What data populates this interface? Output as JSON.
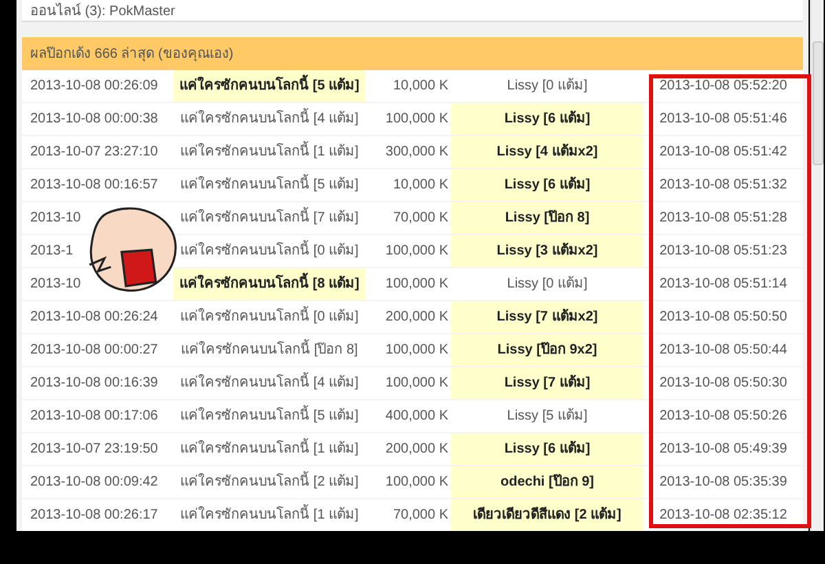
{
  "online_line": "ออนไลน์ (3): PokMaster",
  "results_header": "ผลป๊อกเด้ง 666 ล่าสุด (ของคุณเอง)",
  "rows": [
    {
      "time_1": "2013-10-08 00:26:09",
      "player_1": "แค่ใครซักคนบนโลกนี้ [5 แต้ม]",
      "player_1_won": true,
      "bet": "10,000 K",
      "player_2": "Lissy [0 แต้ม]",
      "player_2_won": false,
      "time_2": "2013-10-08 05:52:20"
    },
    {
      "time_1": "2013-10-08 00:00:38",
      "player_1": "แค่ใครซักคนบนโลกนี้ [4 แต้ม]",
      "player_1_won": false,
      "bet": "100,000 K",
      "player_2": "Lissy [6 แต้ม]",
      "player_2_won": true,
      "time_2": "2013-10-08 05:51:46"
    },
    {
      "time_1": "2013-10-07 23:27:10",
      "player_1": "แค่ใครซักคนบนโลกนี้ [1 แต้ม]",
      "player_1_won": false,
      "bet": "300,000 K",
      "player_2": "Lissy [4 แต้มx2]",
      "player_2_won": true,
      "time_2": "2013-10-08 05:51:42"
    },
    {
      "time_1": "2013-10-08 00:16:57",
      "player_1": "แค่ใครซักคนบนโลกนี้ [5 แต้ม]",
      "player_1_won": false,
      "bet": "10,000 K",
      "player_2": "Lissy [6 แต้ม]",
      "player_2_won": true,
      "time_2": "2013-10-08 05:51:32"
    },
    {
      "time_1": "2013-10",
      "player_1": "แค่ใครซักคนบนโลกนี้ [7 แต้ม]",
      "player_1_won": false,
      "bet": "70,000 K",
      "player_2": "Lissy [ป๊อก 8]",
      "player_2_won": true,
      "time_2": "2013-10-08 05:51:28"
    },
    {
      "time_1": "2013-1",
      "player_1": "แค่ใครซักคนบนโลกนี้ [0 แต้ม]",
      "player_1_won": false,
      "bet": "100,000 K",
      "player_2": "Lissy [3 แต้มx2]",
      "player_2_won": true,
      "time_2": "2013-10-08 05:51:23"
    },
    {
      "time_1": "2013-10",
      "player_1": "แค่ใครซักคนบนโลกนี้ [8 แต้ม]",
      "player_1_won": true,
      "bet": "100,000 K",
      "player_2": "Lissy [0 แต้ม]",
      "player_2_won": false,
      "time_2": "2013-10-08 05:51:14"
    },
    {
      "time_1": "2013-10-08 00:26:24",
      "player_1": "แค่ใครซักคนบนโลกนี้ [0 แต้ม]",
      "player_1_won": false,
      "bet": "200,000 K",
      "player_2": "Lissy [7 แต้มx2]",
      "player_2_won": true,
      "time_2": "2013-10-08 05:50:50"
    },
    {
      "time_1": "2013-10-08 00:00:27",
      "player_1": "แค่ใครซักคนบนโลกนี้ [ป๊อก 8]",
      "player_1_won": false,
      "bet": "100,000 K",
      "player_2": "Lissy [ป๊อก 9x2]",
      "player_2_won": true,
      "time_2": "2013-10-08 05:50:44"
    },
    {
      "time_1": "2013-10-08 00:16:39",
      "player_1": "แค่ใครซักคนบนโลกนี้ [4 แต้ม]",
      "player_1_won": false,
      "bet": "100,000 K",
      "player_2": "Lissy [7 แต้ม]",
      "player_2_won": true,
      "time_2": "2013-10-08 05:50:30"
    },
    {
      "time_1": "2013-10-08 00:17:06",
      "player_1": "แค่ใครซักคนบนโลกนี้ [5 แต้ม]",
      "player_1_won": false,
      "bet": "400,000 K",
      "player_2": "Lissy [5 แต้ม]",
      "player_2_won": false,
      "time_2": "2013-10-08 05:50:26"
    },
    {
      "time_1": "2013-10-07 23:19:50",
      "player_1": "แค่ใครซักคนบนโลกนี้ [1 แต้ม]",
      "player_1_won": false,
      "bet": "200,000 K",
      "player_2": "Lissy [6 แต้ม]",
      "player_2_won": true,
      "time_2": "2013-10-08 05:49:39"
    },
    {
      "time_1": "2013-10-08 00:09:42",
      "player_1": "แค่ใครซักคนบนโลกนี้ [2 แต้ม]",
      "player_1_won": false,
      "bet": "100,000 K",
      "player_2": "odechi [ป๊อก 9]",
      "player_2_won": true,
      "time_2": "2013-10-08 05:35:39"
    },
    {
      "time_1": "2013-10-08 00:26:17",
      "player_1": "แค่ใครซักคนบนโลกนี้ [1 แต้ม]",
      "player_1_won": false,
      "bet": "70,000 K",
      "player_2": "เดียวเดียวดีสีแดง [2 แต้ม]",
      "player_2_won": true,
      "time_2": "2013-10-08 02:35:12"
    }
  ]
}
